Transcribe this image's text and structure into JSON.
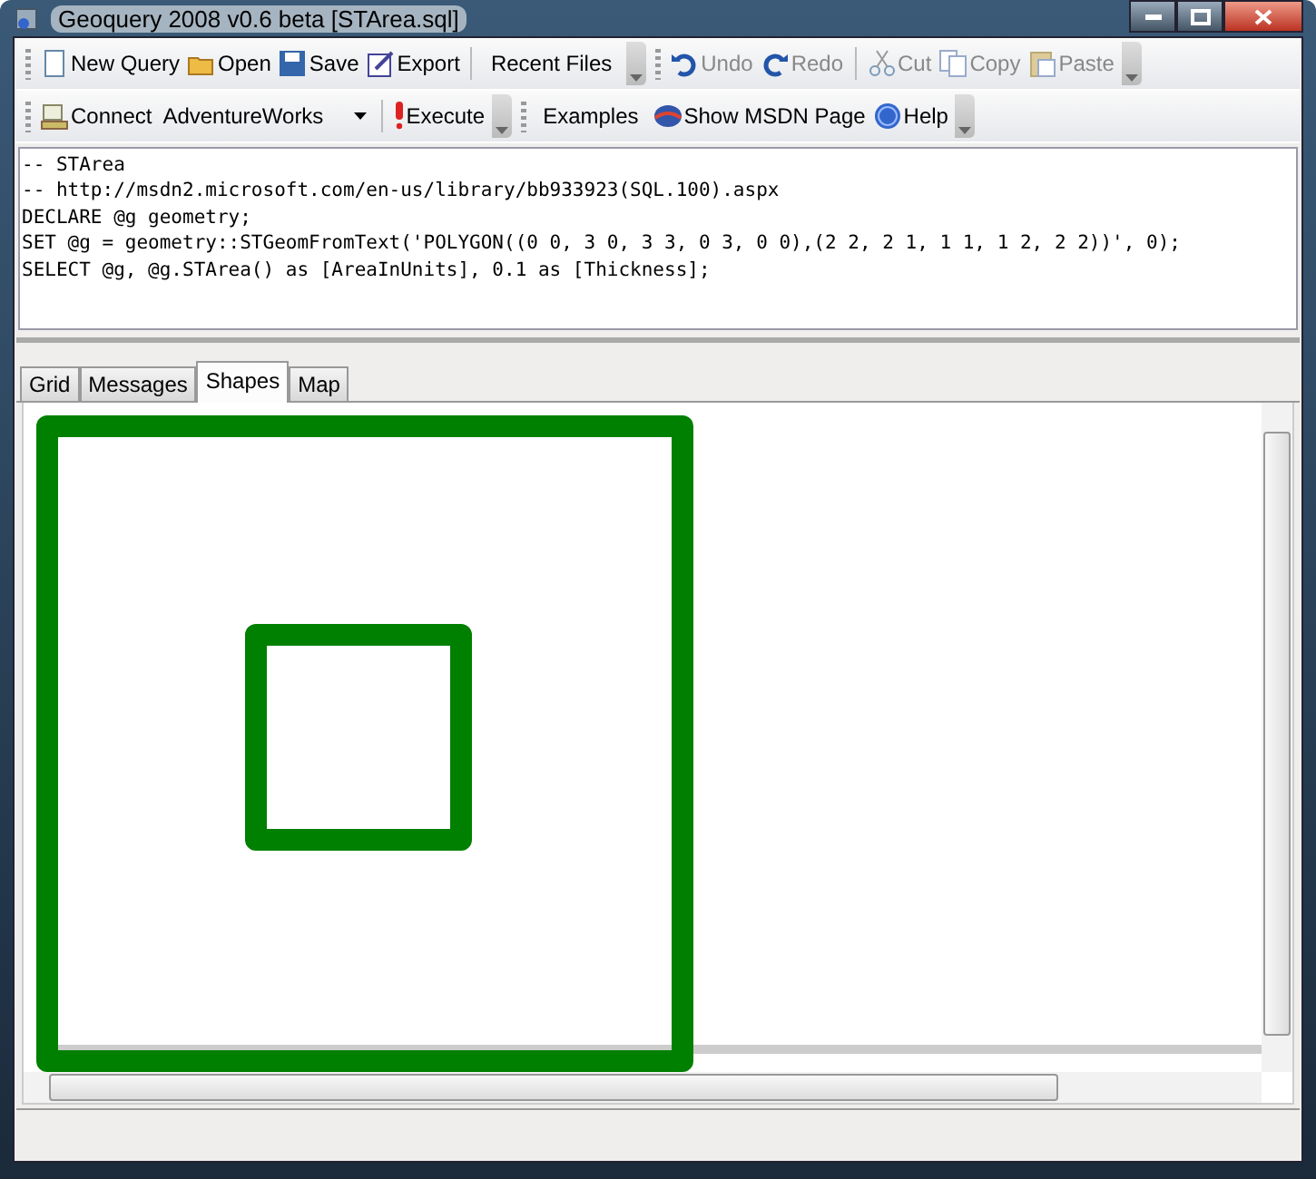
{
  "window": {
    "title": "Geoquery 2008 v0.6 beta [STArea.sql]"
  },
  "toolbars": [
    [
      {
        "kind": "button",
        "label": "New Query",
        "disabled": false
      },
      {
        "kind": "button",
        "label": "Open",
        "disabled": false
      },
      {
        "kind": "button",
        "label": "Save",
        "disabled": false
      },
      {
        "kind": "button",
        "label": "Export",
        "disabled": false
      },
      {
        "kind": "separator"
      },
      {
        "kind": "button",
        "label": "Recent Files",
        "disabled": false
      },
      {
        "kind": "end"
      },
      {
        "kind": "grip"
      },
      {
        "kind": "button",
        "label": "Undo",
        "disabled": true
      },
      {
        "kind": "button",
        "label": "Redo",
        "disabled": true
      },
      {
        "kind": "separator"
      },
      {
        "kind": "button",
        "label": "Cut",
        "disabled": true
      },
      {
        "kind": "button",
        "label": "Copy",
        "disabled": true
      },
      {
        "kind": "button",
        "label": "Paste",
        "disabled": true
      },
      {
        "kind": "end"
      }
    ],
    [
      {
        "kind": "button",
        "label": "Connect",
        "disabled": false
      },
      {
        "kind": "combo",
        "value": "AdventureWorks"
      },
      {
        "kind": "separator"
      },
      {
        "kind": "button",
        "label": "Execute",
        "disabled": false
      },
      {
        "kind": "end"
      },
      {
        "kind": "grip"
      },
      {
        "kind": "button",
        "label": "Examples",
        "disabled": false
      },
      {
        "kind": "button",
        "label": "Show MSDN Page",
        "disabled": false
      },
      {
        "kind": "button",
        "label": "Help",
        "disabled": false
      },
      {
        "kind": "end"
      }
    ]
  ],
  "editor": {
    "lines": [
      "-- STArea",
      "-- http://msdn2.microsoft.com/en-us/library/bb933923(SQL.100).aspx",
      "DECLARE @g geometry;",
      "SET @g = geometry::STGeomFromText('POLYGON((0 0, 3 0, 3 3, 0 3, 0 0),(2 2, 2 1, 1 1, 1 2, 2 2))', 0);",
      "SELECT @g, @g.STArea() as [AreaInUnits], 0.1 as [Thickness];"
    ]
  },
  "tabs": [
    {
      "label": "Grid",
      "selected": false
    },
    {
      "label": "Messages",
      "selected": false
    },
    {
      "label": "Shapes",
      "selected": true
    },
    {
      "label": "Map",
      "selected": false
    }
  ]
}
